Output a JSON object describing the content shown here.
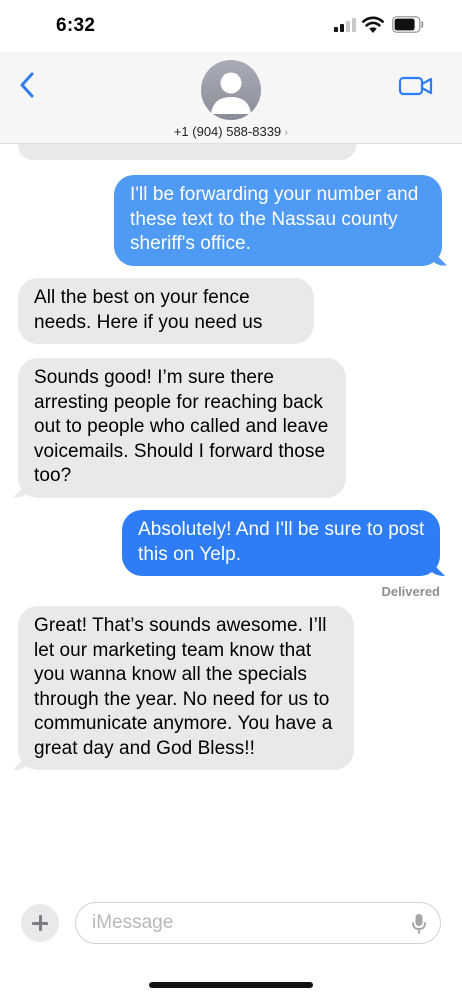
{
  "status_bar": {
    "time": "6:32"
  },
  "header": {
    "contact_number": "+1 (904) 588-8339",
    "contact_chevron": "›",
    "back_icon": "chevron-left-icon",
    "video_icon": "video-camera-icon",
    "accent_color": "#2f7df6"
  },
  "messages": [
    {
      "direction": "outgoing",
      "text": "I'll be forwarding your number and these text to the Nassau county sheriff's office."
    },
    {
      "direction": "incoming",
      "text": "All the best on your fence needs. Here if you need us"
    },
    {
      "direction": "incoming",
      "text": "Sounds good! I’m sure there arresting people for reaching back out to people who called and leave voicemails. Should I forward those too?"
    },
    {
      "direction": "outgoing",
      "text": "Absolutely! And I'll be sure to post this on Yelp."
    },
    {
      "direction": "incoming",
      "text": "Great! That’s sounds awesome. I’ll let our marketing team know that you wanna know all the specials through the year. No need for us to communicate anymore. You have a great day and God Bless!!"
    }
  ],
  "delivered_label": "Delivered",
  "composer": {
    "placeholder": "iMessage",
    "plus_icon": "plus-icon",
    "mic_icon": "microphone-icon"
  }
}
